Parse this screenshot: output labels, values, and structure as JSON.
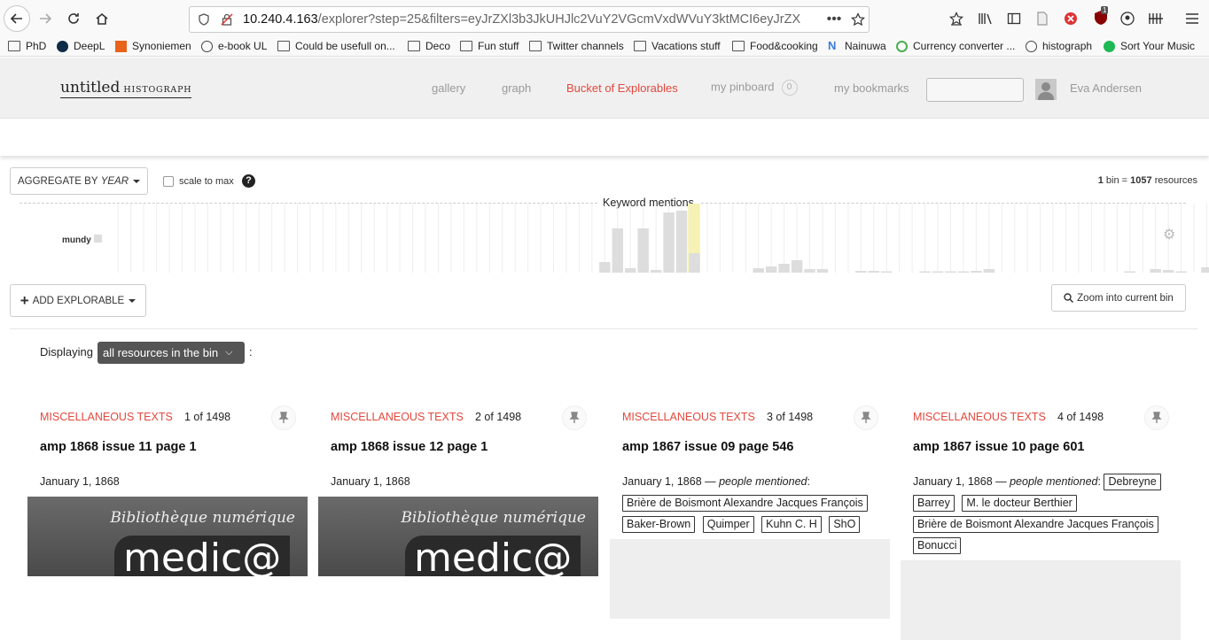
{
  "browser": {
    "url_host": "10.240.4.163",
    "url_path": "/explorer?step=25&filters=eyJrZXl3b3JkUHJlc2VuY2VGcmVxdWVuY3ktMCI6eyJrZX",
    "notification_count": "1"
  },
  "bookmarks": [
    {
      "label": "PhD",
      "icon": "folder-icon"
    },
    {
      "label": "DeepL",
      "icon": "deepl-icon"
    },
    {
      "label": "Synoniemen",
      "icon": "synoniemen-icon"
    },
    {
      "label": "e-book UL",
      "icon": "globe-icon"
    },
    {
      "label": "Could be usefull on...",
      "icon": "folder-icon"
    },
    {
      "label": "Deco",
      "icon": "folder-icon"
    },
    {
      "label": "Fun stuff",
      "icon": "folder-icon"
    },
    {
      "label": "Twitter channels",
      "icon": "folder-icon"
    },
    {
      "label": "Vacations stuff",
      "icon": "folder-icon"
    },
    {
      "label": "Food&cooking",
      "icon": "folder-icon"
    },
    {
      "label": "Nainuwa",
      "icon": "n-icon"
    },
    {
      "label": "Currency converter ...",
      "icon": "currency-icon"
    },
    {
      "label": "histograph",
      "icon": "globe-icon"
    },
    {
      "label": "Sort Your Music",
      "icon": "spotify-icon"
    }
  ],
  "header": {
    "brand": "untitled",
    "brand_small": "HISTOGRAPH",
    "nav": {
      "gallery": "gallery",
      "graph": "graph",
      "bucket": "Bucket of Explorables",
      "pinboard": "my pinboard",
      "pinboard_count": "0",
      "bookmarks": "my bookmarks"
    },
    "search_value": "",
    "user_name": "Eva Andersen"
  },
  "controls": {
    "aggregate_label": "AGGREGATE BY",
    "aggregate_value": "YEAR",
    "scale_label": "scale to max",
    "scale_checked": false,
    "bin_count": "1",
    "bin_text": "bin =",
    "bin_resources": "1057",
    "bin_resources_label": "resources",
    "add_explorable": "ADD EXPLORABLE",
    "zoom_label": "Zoom into current bin"
  },
  "histogram": {
    "title": "Keyword mentions",
    "series_label": "mundy",
    "values": [
      0,
      0,
      0,
      0,
      0,
      0,
      0,
      0,
      0,
      0,
      0,
      0,
      0,
      0,
      0,
      0,
      0,
      0,
      0,
      0,
      0,
      0,
      0,
      0,
      0,
      0,
      0,
      0,
      0,
      0,
      0,
      0,
      0,
      0,
      0,
      0,
      0,
      0,
      12,
      50,
      5,
      50,
      3,
      68,
      70,
      22,
      0,
      0,
      0,
      0,
      5,
      7,
      10,
      14,
      4,
      4,
      0,
      0,
      2,
      2,
      1,
      0,
      0,
      1,
      1,
      1,
      1,
      2,
      4,
      0,
      0,
      0,
      0,
      0,
      0,
      0,
      0,
      0,
      0,
      1,
      0,
      4,
      3,
      1,
      0,
      6,
      0,
      0,
      0,
      0,
      0,
      0,
      8,
      0,
      0,
      0,
      0,
      0,
      0,
      0,
      0,
      0,
      0,
      0,
      0,
      0,
      0,
      0,
      0,
      0,
      0,
      0,
      0,
      0,
      0,
      0,
      0,
      0,
      0,
      0,
      0,
      0
    ],
    "highlight_index": 45
  },
  "displaying": {
    "label": "Displaying",
    "filter_value": "all resources in the bin",
    "colon": ":"
  },
  "cards": [
    {
      "type": "MISCELLANEOUS TEXTS",
      "count": "1 of 1498",
      "title": "amp 1868 issue 11 page 1",
      "date": "January 1, 1868",
      "people_label": "",
      "people": [],
      "thumb_top": "Bibliothèque numérique",
      "thumb_logo": "medic@"
    },
    {
      "type": "MISCELLANEOUS TEXTS",
      "count": "2 of 1498",
      "title": "amp 1868 issue 12 page 1",
      "date": "January 1, 1868",
      "people_label": "",
      "people": [],
      "thumb_top": "Bibliothèque numérique",
      "thumb_logo": "medic@"
    },
    {
      "type": "MISCELLANEOUS TEXTS",
      "count": "3 of 1498",
      "title": "amp 1867 issue 09 page 546",
      "date": "January 1, 1868",
      "people_label": "people mentioned",
      "people": [
        "Brière de Boismont Alexandre Jacques François",
        "Baker-Brown",
        "Quimper",
        "Kuhn C. H",
        "ShO"
      ],
      "thumb_top": "",
      "thumb_logo": ""
    },
    {
      "type": "MISCELLANEOUS TEXTS",
      "count": "4 of 1498",
      "title": "amp 1867 issue 10 page 601",
      "date": "January 1, 1868",
      "people_label": "people mentioned",
      "people": [
        "Debreyne",
        "Barrey",
        "M. le docteur Berthier",
        "Brière de Boismont Alexandre Jacques François",
        "Bonucci"
      ],
      "thumb_top": "",
      "thumb_logo": ""
    }
  ],
  "colors": {
    "accent": "#e3483d",
    "bar": "#dddddd",
    "bar_highlight": "#f6f1b4",
    "header_bg": "#f0f0f0"
  }
}
